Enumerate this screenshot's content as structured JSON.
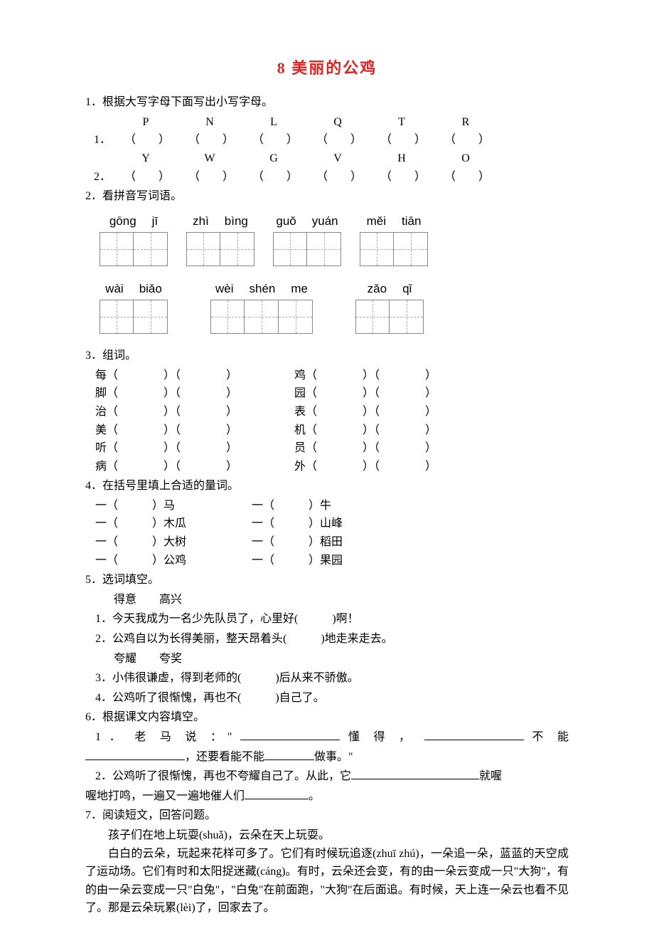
{
  "title": "8 美丽的公鸡",
  "q1": {
    "prompt": "1．根据大写字母下面写出小写字母。",
    "row1_letters": [
      "P",
      "N",
      "L",
      "Q",
      "T",
      "R"
    ],
    "row1_label": "1．",
    "row2_letters": [
      "Y",
      "W",
      "G",
      "V",
      "H",
      "O"
    ],
    "row2_label": "2．",
    "paren_l": "（",
    "paren_r": "）"
  },
  "q2": {
    "prompt": "2．看拼音写词语。",
    "row1": [
      [
        "gōng",
        "jī"
      ],
      [
        "zhì",
        "bìng"
      ],
      [
        "guǒ",
        "yuán"
      ],
      [
        "měi",
        "tiān"
      ]
    ],
    "row2": [
      [
        "wài",
        "biǎo"
      ],
      [
        "wèi",
        "shén",
        "me"
      ],
      [
        "zǎo",
        "qǐ"
      ]
    ]
  },
  "q3": {
    "prompt": "3．组词。",
    "rows": [
      [
        "每（",
        "）（",
        "）",
        "鸡（",
        "）（",
        "）"
      ],
      [
        "脚（",
        "）（",
        "）",
        "园（",
        "）（",
        "）"
      ],
      [
        "治（",
        "）（",
        "）",
        "表（",
        "）（",
        "）"
      ],
      [
        "美（",
        "）（",
        "）",
        "机（",
        "）（",
        "）"
      ],
      [
        "听（",
        "）（",
        "）",
        "员（",
        "）（",
        "）"
      ],
      [
        "病（",
        "）（",
        "）",
        "外（",
        "）（",
        "）"
      ]
    ],
    "col1": [
      "每",
      "脚",
      "治",
      "美",
      "听",
      "病"
    ],
    "col2": [
      "鸡",
      "园",
      "表",
      "机",
      "员",
      "外"
    ]
  },
  "q4": {
    "prompt": "4．在括号里填上合适的量词。",
    "rows": [
      [
        "一（　　　）马",
        "一（　　　）牛"
      ],
      [
        "一（　　　）木瓜",
        "一（　　　）山峰"
      ],
      [
        "一（　　　）大树",
        "一（　　　）稻田"
      ],
      [
        "一（　　　）公鸡",
        "一（　　　）果园"
      ]
    ]
  },
  "q5": {
    "prompt": "5．选词填空。",
    "pair1": "得意　　高兴",
    "s1": "1．今天我成为一名少先队员了，心里好(　　　)啊！",
    "s2": "2．公鸡自以为长得美丽，整天昂着头(　　　)地走来走去。",
    "pair2": "夸耀　　夸奖",
    "s3": "3．小伟很谦虚，得到老师的(　　　)后从来不骄傲。",
    "s4": "4．公鸡听了很惭愧，再也不(　　　)自己了。"
  },
  "q6": {
    "prompt": "6．根据课文内容填空。",
    "line1a": "1 ． 老 马 说 ：\" ",
    "line1b": " 懂 得 ， ",
    "line1c": " 不 能",
    "line2a": "，还要看能不能",
    "line2b": "做事。\"",
    "line3a": "2．公鸡听了很惭愧，再也不夸耀自己了。从此，它",
    "line3b": "就喔",
    "line4a": "喔地打鸣，一遍又一遍地催人们",
    "line4b": "。"
  },
  "q7": {
    "prompt": "7．阅读短文，回答问题。",
    "p1": "孩子们在地上玩耍(shuǎ)，云朵在天上玩耍。",
    "p2": "白白的云朵，玩起来花样可多了。它们有时候玩追逐(zhuī zhú)，一朵追一朵，蓝蓝的天空成了运动场。它们有时和太阳捉迷藏(cáng)。有时，云朵还会变，有的由一朵云变成一只\"大狗\"，有的由一朵云变成一只\"白兔\"，\"白兔\"在前面跑，\"大狗\"在后面追。有时候，天上连一朵云也看不见了。那是云朵玩累(lèi)了，回家去了。"
  }
}
